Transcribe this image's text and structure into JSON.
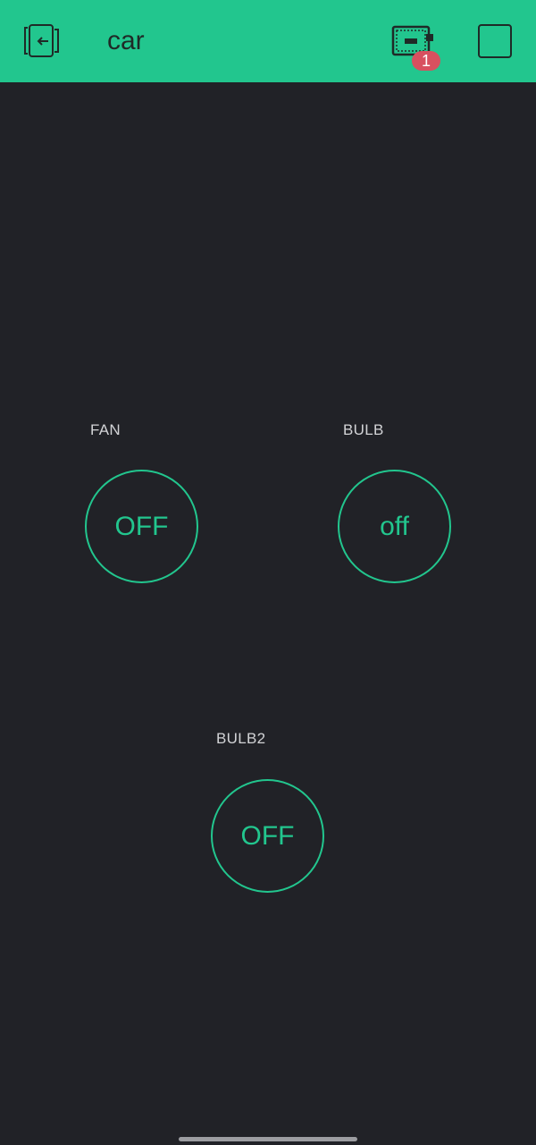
{
  "header": {
    "title": "car",
    "back_icon": "exit-project-icon",
    "device_icon": "device-board-icon",
    "device_count": "1",
    "stop_icon": "square-stop-icon",
    "bar_color": "#22c68e"
  },
  "widgets": [
    {
      "label": "FAN",
      "state": "OFF"
    },
    {
      "label": "BULB",
      "state": "off"
    },
    {
      "label": "BULB2",
      "state": "OFF"
    }
  ],
  "colors": {
    "accent": "#22c68e",
    "background": "#212227",
    "badge": "#d8505f"
  }
}
